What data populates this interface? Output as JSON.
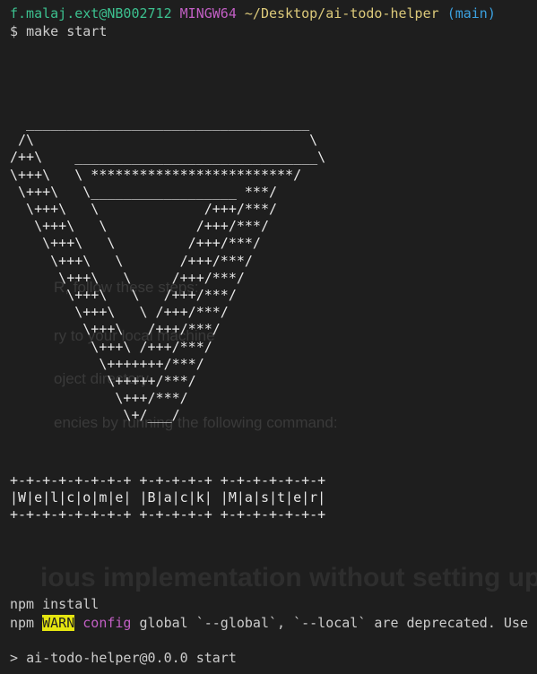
{
  "prompt": {
    "user": "f.malaj.ext@NB002712",
    "system": "MINGW64",
    "path": "~/Desktop/ai-todo-helper",
    "branch": "(main)",
    "symbol": "$",
    "command": "make start"
  },
  "ascii_art": [
    "  ___________________________________",
    " /\\                                  \\",
    "/++\\    ______________________________\\",
    "\\+++\\   \\ *************************/",
    " \\+++\\   \\__________________ ***/",
    "  \\+++\\   \\             /+++/***/",
    "   \\+++\\   \\           /+++/***/",
    "    \\+++\\   \\         /+++/***/",
    "     \\+++\\   \\       /+++/***/",
    "      \\+++\\   \\     /+++/***/",
    "       \\+++\\   \\   /+++/***/",
    "        \\+++\\   \\ /+++/***/",
    "         \\+++\\   /+++/***/",
    "          \\+++\\ /+++/***/",
    "           \\+++++++/***/",
    "            \\+++++/***/",
    "             \\+++/***/",
    "              \\+/___/"
  ],
  "banner": [
    "+-+-+-+-+-+-+-+ +-+-+-+-+ +-+-+-+-+-+-+",
    "|W|e|l|c|o|m|e| |B|a|c|k| |M|a|s|t|e|r|",
    "+-+-+-+-+-+-+-+ +-+-+-+-+ +-+-+-+-+-+-+"
  ],
  "background_text": {
    "line1": "R, follow these steps:",
    "line2": "ry to your local machine",
    "line3": "oject directory",
    "line4": "encies by running the following command:",
    "heading": "ious implementation without setting up a pr"
  },
  "npm_install": "npm install",
  "npm_warn": {
    "npm": "npm",
    "badge": "WARN",
    "word": "config",
    "message": " global `--global`, `--local` are deprecated. Use `"
  },
  "start_line": {
    "symbol": ">",
    "text": "ai-todo-helper@0.0.0 start"
  },
  "colors": {
    "background": "#1e1e1e",
    "user": "#3cc08f",
    "system": "#c25fc4",
    "path": "#dcc97a",
    "branch": "#3ba1e0",
    "warn_bg": "#e5e510"
  }
}
